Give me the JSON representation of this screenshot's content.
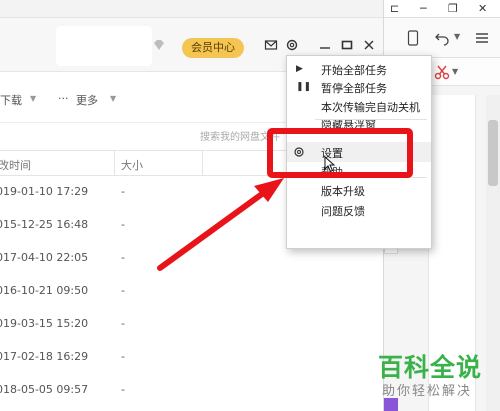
{
  "header": {
    "vip_label": "会员中心"
  },
  "toolbar": {
    "download_label": "下载",
    "more_label": "更多"
  },
  "search": {
    "placeholder": "搜索我的网盘文件"
  },
  "columns": {
    "modified": "改时间",
    "size": "大小"
  },
  "rows": [
    {
      "date": "019-01-10 17:29",
      "size": "-"
    },
    {
      "date": "015-12-25 16:48",
      "size": "-"
    },
    {
      "date": "017-04-10 22:05",
      "size": "-"
    },
    {
      "date": "016-10-21 09:50",
      "size": "-"
    },
    {
      "date": "019-03-15 15:20",
      "size": "-"
    },
    {
      "date": "017-02-18 16:29",
      "size": "-"
    },
    {
      "date": "018-05-05 09:57",
      "size": "-"
    }
  ],
  "menu": {
    "start_all": "开始全部任务",
    "pause_all": "暂停全部任务",
    "shutdown_after": "本次传输完自动关机",
    "hidden_item": "隐藏悬浮窗",
    "settings": "设置",
    "help": "帮助",
    "upgrade": "版本升级",
    "feedback": "问题反馈"
  },
  "watermark": {
    "title": "百科全说",
    "subtitle": "助你轻松解决"
  },
  "colors": {
    "vip": "#f4c552",
    "annotation": "#e8141a",
    "watermark": "#3ab24a"
  }
}
